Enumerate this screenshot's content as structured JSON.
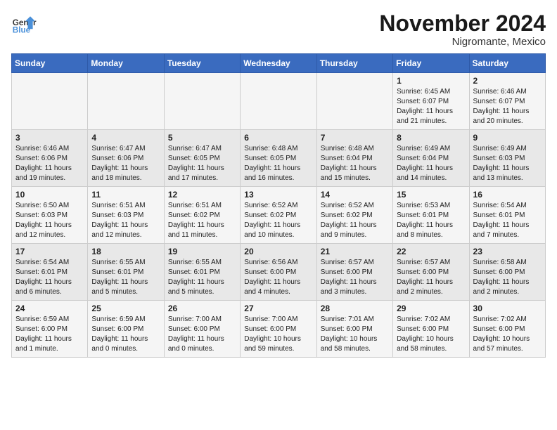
{
  "logo": {
    "line1": "General",
    "line2": "Blue"
  },
  "title": "November 2024",
  "subtitle": "Nigromante, Mexico",
  "days_of_week": [
    "Sunday",
    "Monday",
    "Tuesday",
    "Wednesday",
    "Thursday",
    "Friday",
    "Saturday"
  ],
  "weeks": [
    [
      {
        "day": "",
        "content": ""
      },
      {
        "day": "",
        "content": ""
      },
      {
        "day": "",
        "content": ""
      },
      {
        "day": "",
        "content": ""
      },
      {
        "day": "",
        "content": ""
      },
      {
        "day": "1",
        "content": "Sunrise: 6:45 AM\nSunset: 6:07 PM\nDaylight: 11 hours\nand 21 minutes."
      },
      {
        "day": "2",
        "content": "Sunrise: 6:46 AM\nSunset: 6:07 PM\nDaylight: 11 hours\nand 20 minutes."
      }
    ],
    [
      {
        "day": "3",
        "content": "Sunrise: 6:46 AM\nSunset: 6:06 PM\nDaylight: 11 hours\nand 19 minutes."
      },
      {
        "day": "4",
        "content": "Sunrise: 6:47 AM\nSunset: 6:06 PM\nDaylight: 11 hours\nand 18 minutes."
      },
      {
        "day": "5",
        "content": "Sunrise: 6:47 AM\nSunset: 6:05 PM\nDaylight: 11 hours\nand 17 minutes."
      },
      {
        "day": "6",
        "content": "Sunrise: 6:48 AM\nSunset: 6:05 PM\nDaylight: 11 hours\nand 16 minutes."
      },
      {
        "day": "7",
        "content": "Sunrise: 6:48 AM\nSunset: 6:04 PM\nDaylight: 11 hours\nand 15 minutes."
      },
      {
        "day": "8",
        "content": "Sunrise: 6:49 AM\nSunset: 6:04 PM\nDaylight: 11 hours\nand 14 minutes."
      },
      {
        "day": "9",
        "content": "Sunrise: 6:49 AM\nSunset: 6:03 PM\nDaylight: 11 hours\nand 13 minutes."
      }
    ],
    [
      {
        "day": "10",
        "content": "Sunrise: 6:50 AM\nSunset: 6:03 PM\nDaylight: 11 hours\nand 12 minutes."
      },
      {
        "day": "11",
        "content": "Sunrise: 6:51 AM\nSunset: 6:03 PM\nDaylight: 11 hours\nand 12 minutes."
      },
      {
        "day": "12",
        "content": "Sunrise: 6:51 AM\nSunset: 6:02 PM\nDaylight: 11 hours\nand 11 minutes."
      },
      {
        "day": "13",
        "content": "Sunrise: 6:52 AM\nSunset: 6:02 PM\nDaylight: 11 hours\nand 10 minutes."
      },
      {
        "day": "14",
        "content": "Sunrise: 6:52 AM\nSunset: 6:02 PM\nDaylight: 11 hours\nand 9 minutes."
      },
      {
        "day": "15",
        "content": "Sunrise: 6:53 AM\nSunset: 6:01 PM\nDaylight: 11 hours\nand 8 minutes."
      },
      {
        "day": "16",
        "content": "Sunrise: 6:54 AM\nSunset: 6:01 PM\nDaylight: 11 hours\nand 7 minutes."
      }
    ],
    [
      {
        "day": "17",
        "content": "Sunrise: 6:54 AM\nSunset: 6:01 PM\nDaylight: 11 hours\nand 6 minutes."
      },
      {
        "day": "18",
        "content": "Sunrise: 6:55 AM\nSunset: 6:01 PM\nDaylight: 11 hours\nand 5 minutes."
      },
      {
        "day": "19",
        "content": "Sunrise: 6:55 AM\nSunset: 6:01 PM\nDaylight: 11 hours\nand 5 minutes."
      },
      {
        "day": "20",
        "content": "Sunrise: 6:56 AM\nSunset: 6:00 PM\nDaylight: 11 hours\nand 4 minutes."
      },
      {
        "day": "21",
        "content": "Sunrise: 6:57 AM\nSunset: 6:00 PM\nDaylight: 11 hours\nand 3 minutes."
      },
      {
        "day": "22",
        "content": "Sunrise: 6:57 AM\nSunset: 6:00 PM\nDaylight: 11 hours\nand 2 minutes."
      },
      {
        "day": "23",
        "content": "Sunrise: 6:58 AM\nSunset: 6:00 PM\nDaylight: 11 hours\nand 2 minutes."
      }
    ],
    [
      {
        "day": "24",
        "content": "Sunrise: 6:59 AM\nSunset: 6:00 PM\nDaylight: 11 hours\nand 1 minute."
      },
      {
        "day": "25",
        "content": "Sunrise: 6:59 AM\nSunset: 6:00 PM\nDaylight: 11 hours\nand 0 minutes."
      },
      {
        "day": "26",
        "content": "Sunrise: 7:00 AM\nSunset: 6:00 PM\nDaylight: 11 hours\nand 0 minutes."
      },
      {
        "day": "27",
        "content": "Sunrise: 7:00 AM\nSunset: 6:00 PM\nDaylight: 10 hours\nand 59 minutes."
      },
      {
        "day": "28",
        "content": "Sunrise: 7:01 AM\nSunset: 6:00 PM\nDaylight: 10 hours\nand 58 minutes."
      },
      {
        "day": "29",
        "content": "Sunrise: 7:02 AM\nSunset: 6:00 PM\nDaylight: 10 hours\nand 58 minutes."
      },
      {
        "day": "30",
        "content": "Sunrise: 7:02 AM\nSunset: 6:00 PM\nDaylight: 10 hours\nand 57 minutes."
      }
    ]
  ]
}
